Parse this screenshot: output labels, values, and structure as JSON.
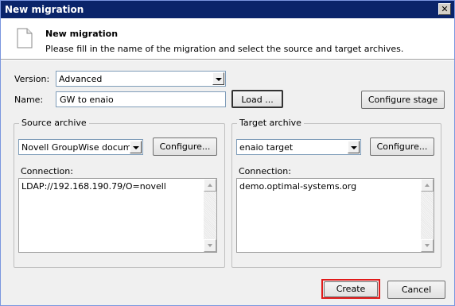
{
  "window": {
    "title": "New migration",
    "close_glyph": "✕"
  },
  "header": {
    "title": "New migration",
    "subtitle": "Please fill in the name of the migration and select the source and target archives.",
    "icon": "document-icon"
  },
  "form": {
    "version_label": "Version:",
    "version_value": "Advanced",
    "name_label": "Name:",
    "name_value": "GW to enaio",
    "load_button": "Load ...",
    "configure_stage_button": "Configure stage"
  },
  "source": {
    "group_title": "Source archive",
    "archive_value": "Novell GroupWise docume",
    "configure_button": "Configure...",
    "connection_label": "Connection:",
    "connection_value": "LDAP://192.168.190.79/O=novell"
  },
  "target": {
    "group_title": "Target archive",
    "archive_value": "enaio target",
    "configure_button": "Configure...",
    "connection_label": "Connection:",
    "connection_value": "demo.optimal-systems.org"
  },
  "footer": {
    "create_button": "Create",
    "cancel_button": "Cancel"
  },
  "colors": {
    "titlebar": "#0a246a",
    "highlight": "#e01b1b"
  }
}
